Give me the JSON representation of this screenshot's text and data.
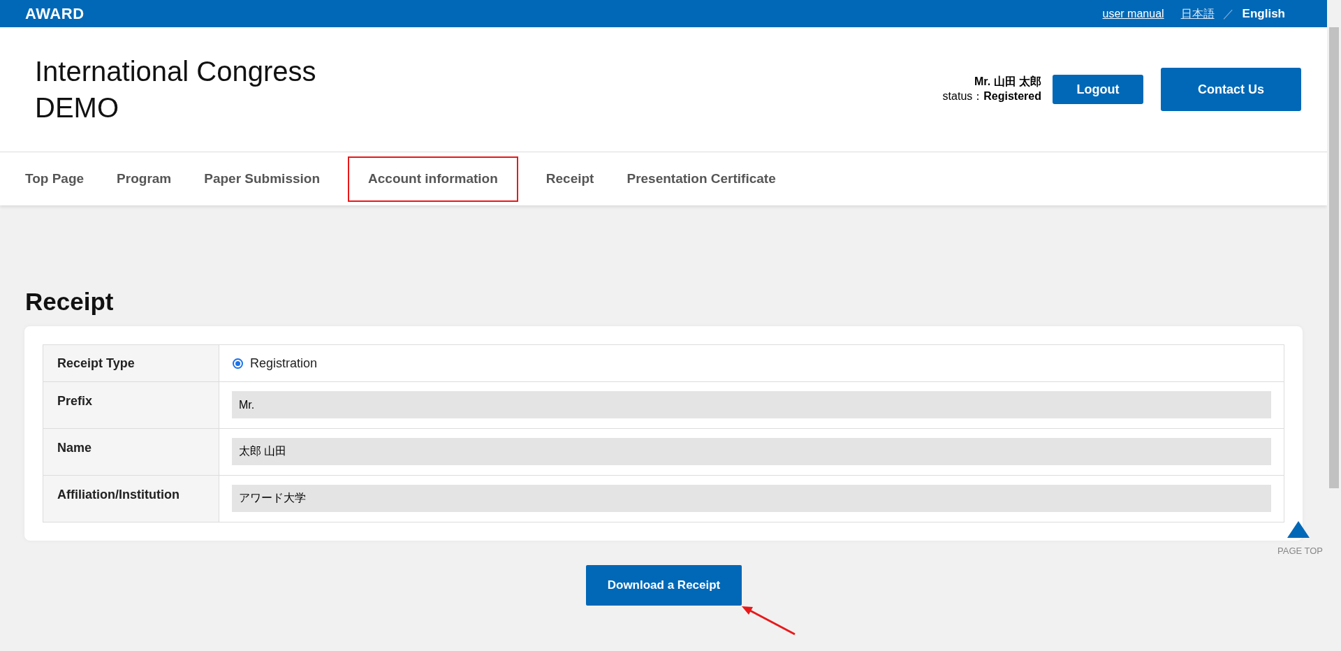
{
  "top_bar": {
    "logo": "AWARD",
    "manual_link": "user manual",
    "languages": [
      {
        "label": "日本語",
        "selected": false
      },
      {
        "label": "English",
        "selected": true
      }
    ],
    "separator": "／"
  },
  "header": {
    "title_lines": [
      "International Congress",
      "DEMO"
    ],
    "user_name": "Mr. 山田 太郎",
    "status_label": "status：",
    "status_value": "Registered",
    "logout": "Logout",
    "contact": "Contact Us"
  },
  "nav": {
    "items": [
      {
        "label": "Top Page",
        "highlighted": false
      },
      {
        "label": "Program",
        "highlighted": false
      },
      {
        "label": "Paper Submission",
        "highlighted": false
      },
      {
        "label": "Account information",
        "highlighted": true
      },
      {
        "label": "Receipt",
        "highlighted": false
      },
      {
        "label": "Presentation Certificate",
        "highlighted": false
      }
    ]
  },
  "page_title": "Receipt",
  "form": {
    "rows": [
      {
        "kind": "radio",
        "label": "Receipt Type",
        "option": "Registration",
        "checked": true
      },
      {
        "kind": "field",
        "label": "Prefix",
        "value": "Mr."
      },
      {
        "kind": "field",
        "label": "Name",
        "value": "太郎 山田"
      },
      {
        "kind": "field",
        "label": "Affiliation/Institution",
        "value": "アワード大学"
      }
    ]
  },
  "download_button": "Download a Receipt",
  "page_top": "PAGE TOP"
}
